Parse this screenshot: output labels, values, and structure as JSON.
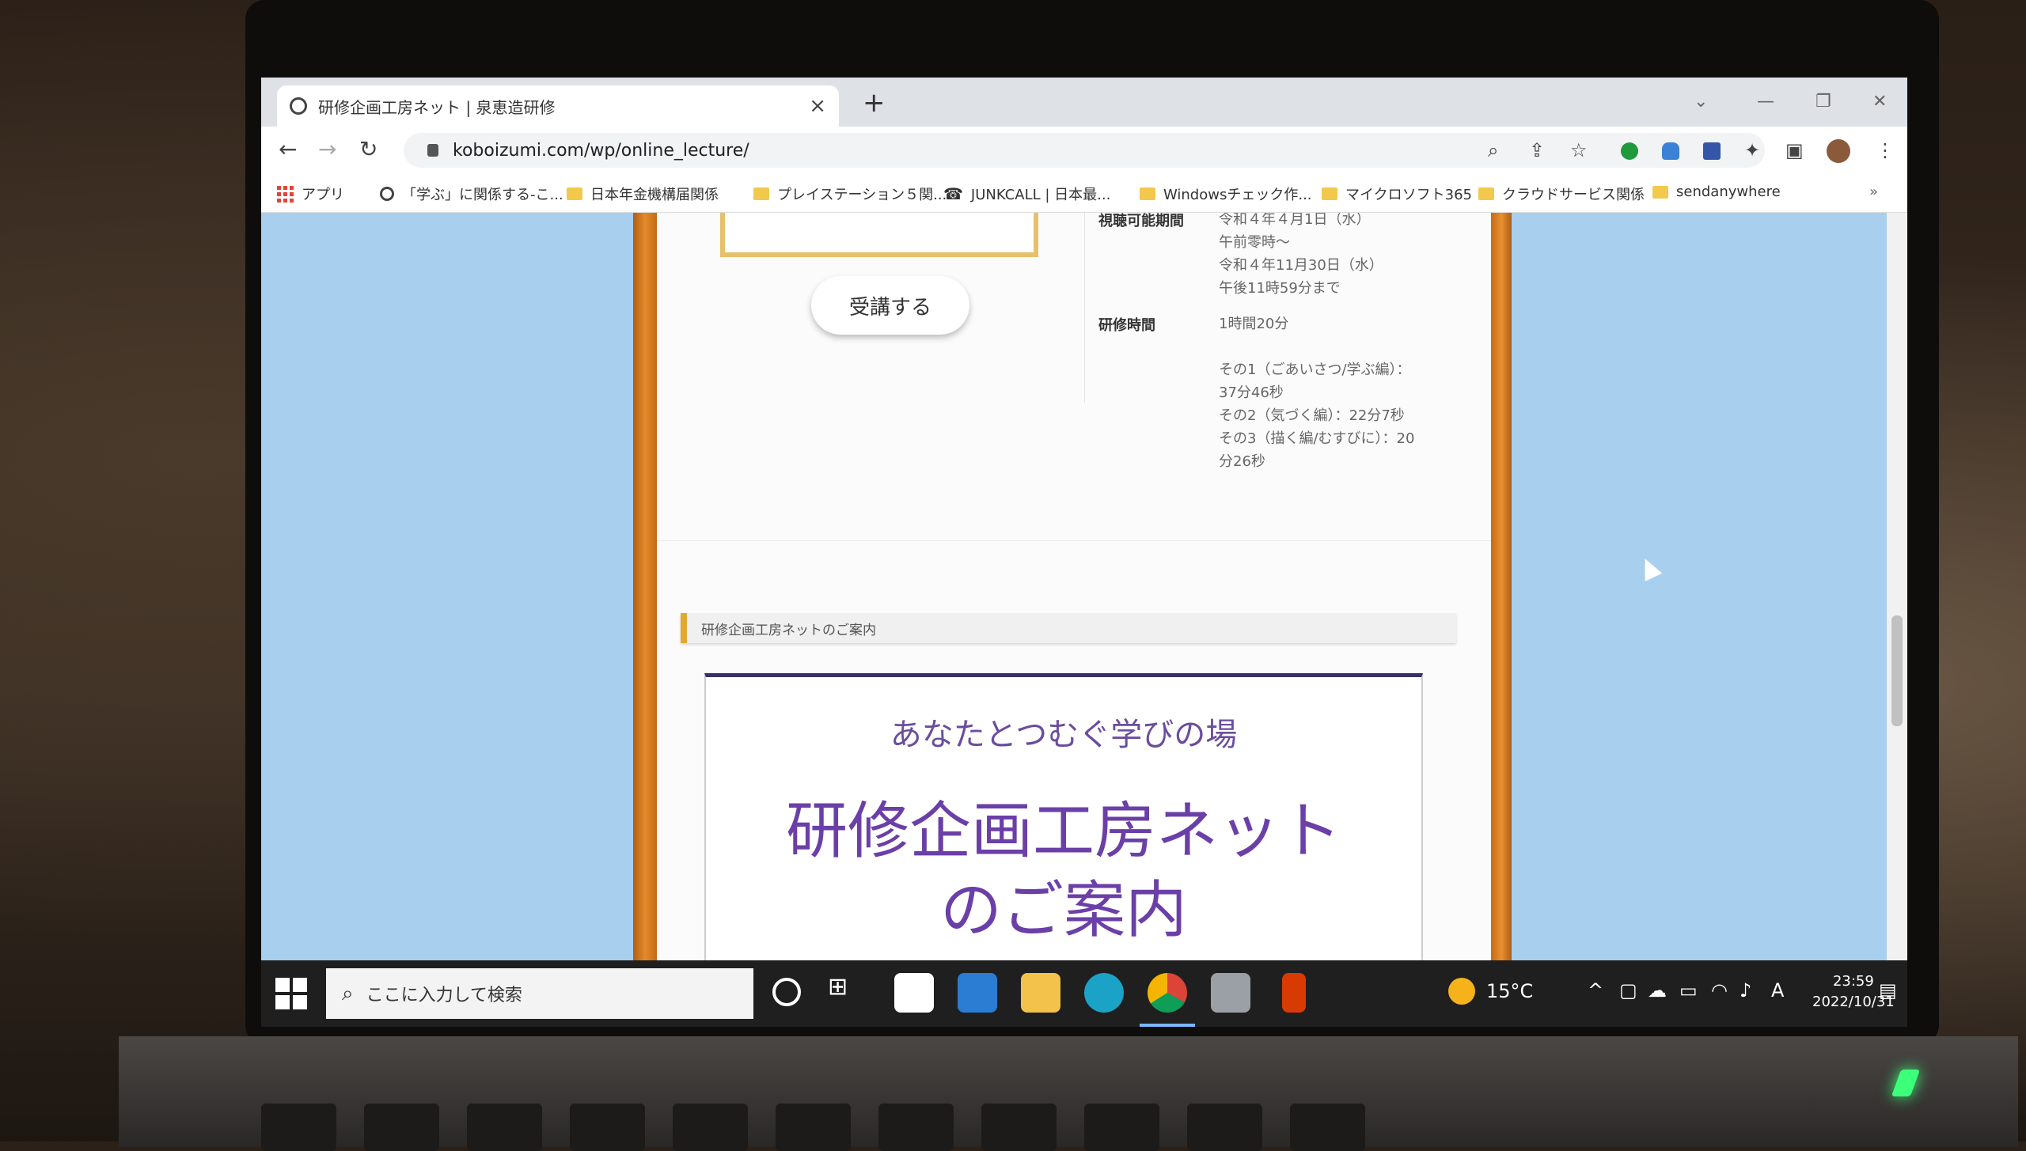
{
  "browser": {
    "tab_title": "研修企画工房ネット | 泉恵造研修",
    "url": "koboizumi.com/wp/online_lecture/",
    "bookmarks": [
      "アプリ",
      "「学ぶ」に関係する-こ...",
      "日本年金機構届関係",
      "プレイステーション５関...",
      "JUNKCALL | 日本最...",
      "Windowsチェック作...",
      "マイクロソフト365",
      "クラウドサービス関係",
      "sendanywhere"
    ]
  },
  "page": {
    "enroll_button": "受講する",
    "info": {
      "period_label": "視聴可能期間",
      "period_lines": [
        "令和４年４月1日（水）",
        "午前零時～",
        "令和４年11月30日（水）",
        "午後11時59分まで"
      ],
      "duration_label": "研修時間",
      "duration_value": "1時間20分",
      "parts": [
        "その1（ごあいさつ/学ぶ編）：",
        "37分46秒",
        "その2（気づく編）：22分7秒",
        "その3（描く編/むすびに）：20",
        "分26秒"
      ]
    },
    "section_header": "研修企画工房ネットのご案内",
    "banner": {
      "subtitle": "あなたとつむぐ学びの場",
      "title_line1": "研修企画工房ネット",
      "title_line2": "のご案内"
    }
  },
  "taskbar": {
    "search_placeholder": "ここに入力して検索",
    "temperature": "15°C",
    "ime": "A",
    "time": "23:59",
    "date": "2022/10/31"
  },
  "colors": {
    "page_bg": "#a9cfee",
    "border_orange": "#e48a2a",
    "banner_purple": "#6b3fa8"
  }
}
